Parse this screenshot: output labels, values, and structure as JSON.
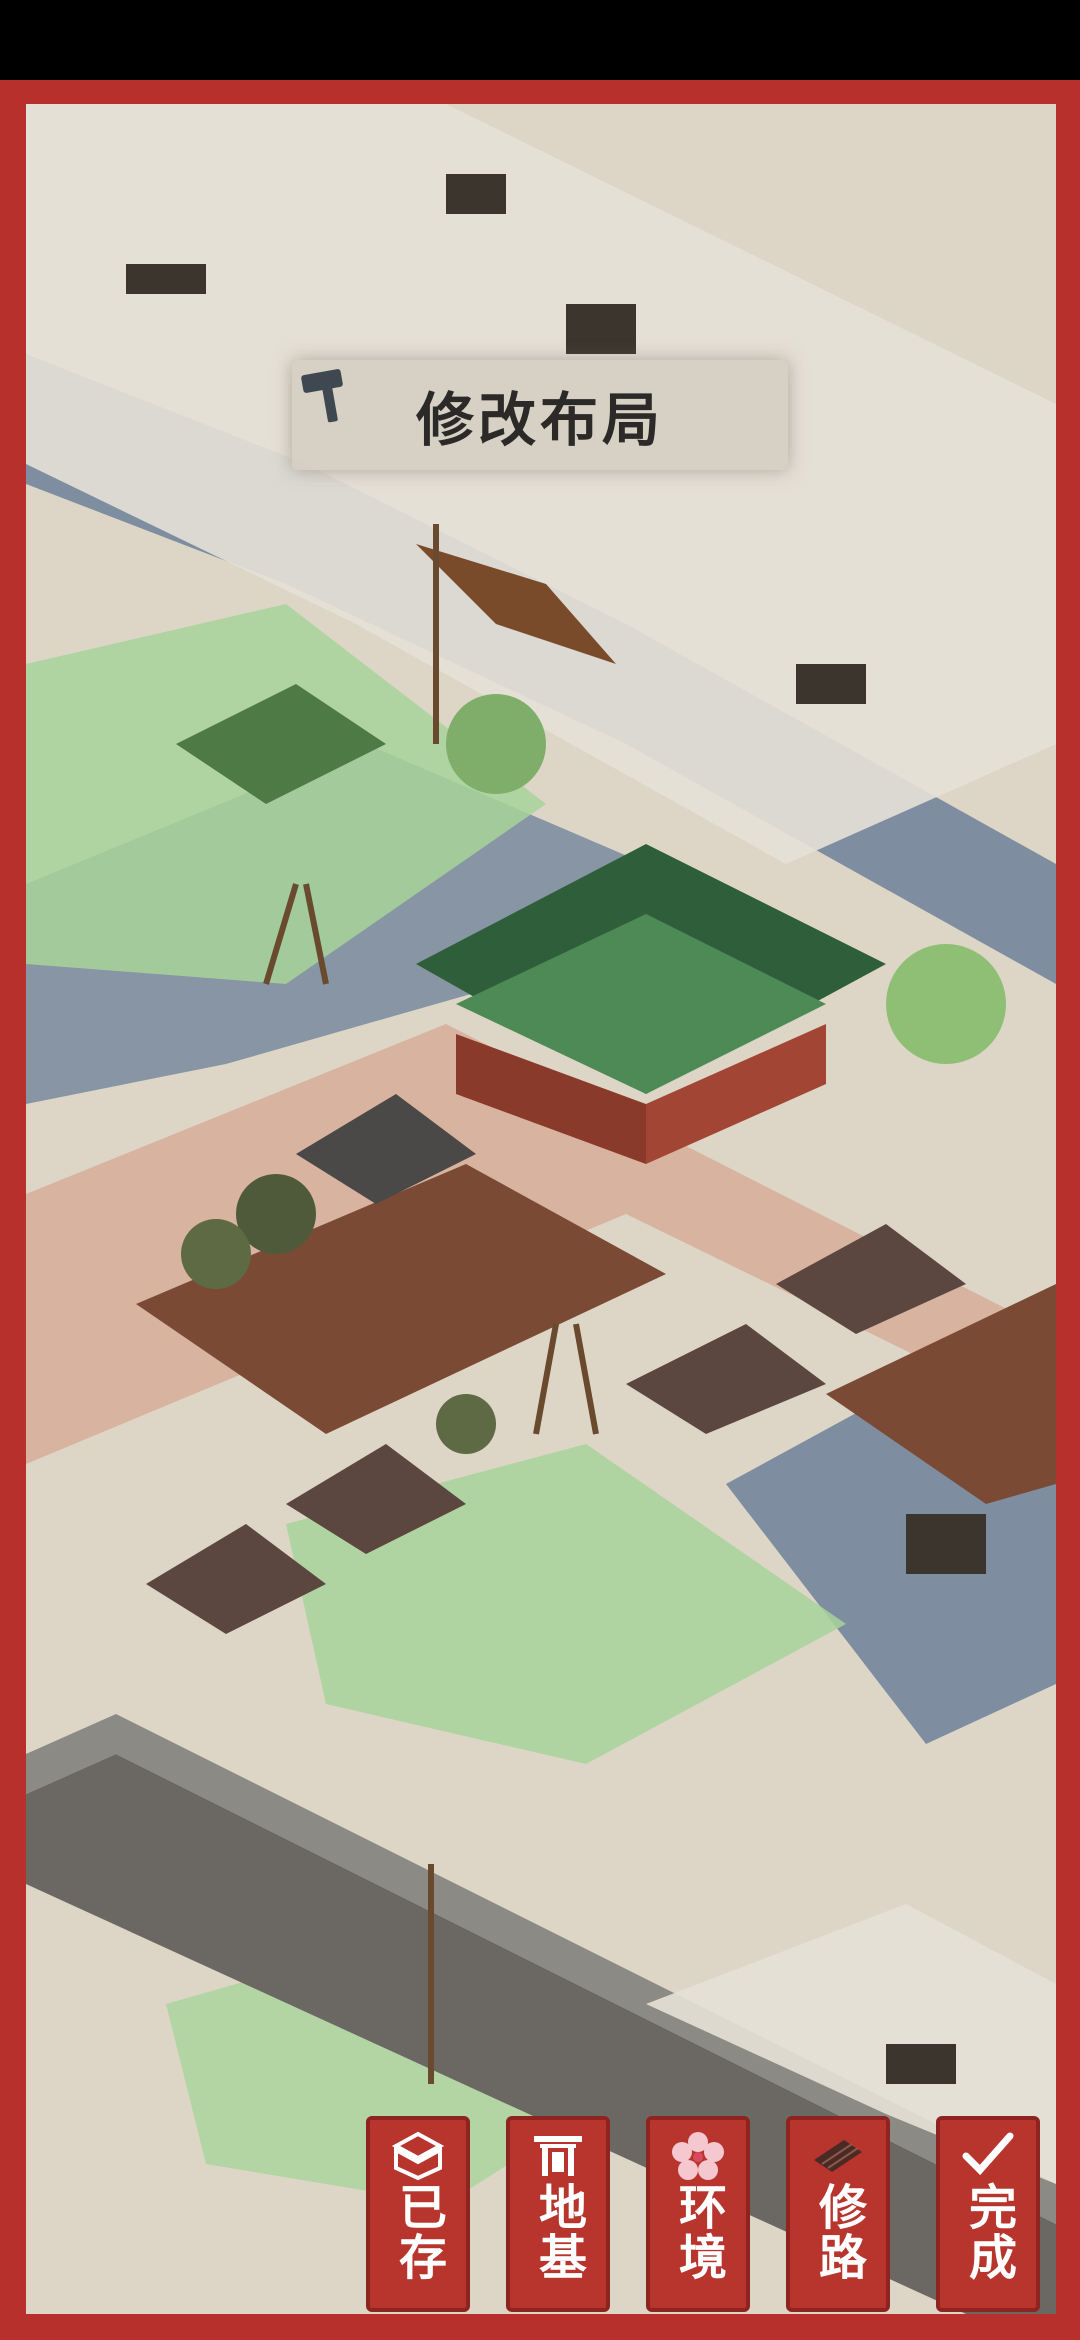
{
  "mode_banner": {
    "title": "修改布局",
    "icon": "hammer-icon"
  },
  "toolbar": {
    "buttons": [
      {
        "id": "saved",
        "label": "已存",
        "icon": "storage-box-icon"
      },
      {
        "id": "foundation",
        "label": "地基",
        "icon": "gate-icon"
      },
      {
        "id": "environment",
        "label": "环境",
        "icon": "plum-blossom-icon"
      },
      {
        "id": "road",
        "label": "修路",
        "icon": "road-tile-icon"
      },
      {
        "id": "done",
        "label": "完成",
        "icon": "checkmark-icon"
      }
    ]
  },
  "colors": {
    "frame": "#b8302b",
    "button": "#b8352e",
    "water": "#7d8fa0",
    "grass_highlight": "#a7d49a"
  }
}
